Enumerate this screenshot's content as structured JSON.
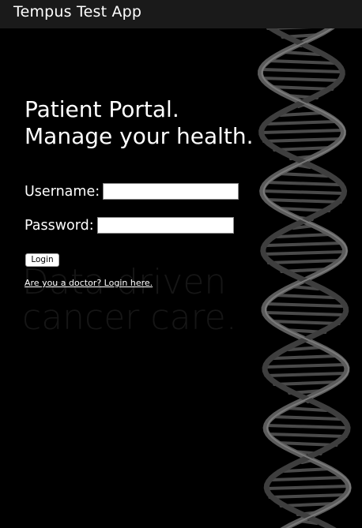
{
  "header": {
    "app_title": "Tempus Test App"
  },
  "hero": {
    "line1": "Patient Portal.",
    "line2": "Manage your health."
  },
  "background_slogan": {
    "line1": "Data driven",
    "line2": "cancer care."
  },
  "form": {
    "username_label": "Username:",
    "username_value": "",
    "password_label": "Password:",
    "password_value": "",
    "login_button": "Login"
  },
  "doctor_link": "Are you a doctor? Login here.",
  "colors": {
    "background": "#000000",
    "topbar": "#1a1a1a",
    "text": "#ffffff"
  },
  "decorations": {
    "background_graphic": "dna-helix"
  }
}
